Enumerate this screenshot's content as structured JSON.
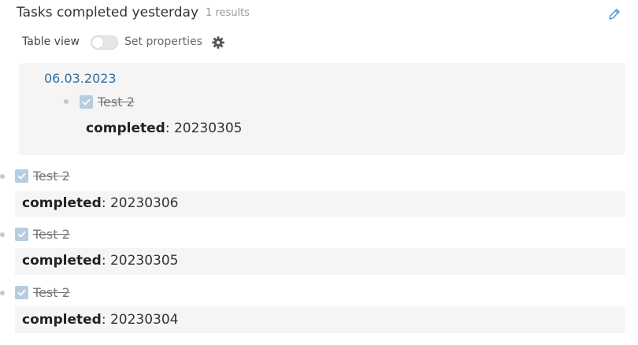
{
  "header": {
    "title": "Tasks completed yesterday",
    "results": "1 results"
  },
  "controls": {
    "table_view_label": "Table view",
    "table_view_on": false,
    "set_properties_label": "Set properties"
  },
  "group": {
    "title": "06.03.2023",
    "task": {
      "text": "Test 2",
      "checked": true,
      "property_key": "completed",
      "property_sep": ":",
      "property_value": "20230305"
    }
  },
  "tasks": [
    {
      "text": "Test 2",
      "checked": true,
      "property_key": "completed",
      "property_sep": ":",
      "property_value": "20230306"
    },
    {
      "text": "Test 2",
      "checked": true,
      "property_key": "completed",
      "property_sep": ":",
      "property_value": "20230305"
    },
    {
      "text": "Test 2",
      "checked": true,
      "property_key": "completed",
      "property_sep": ":",
      "property_value": "20230304"
    }
  ],
  "colors": {
    "link": "#2f6ea1",
    "checkbox": "#b8cce0",
    "panel": "#f5f5f5",
    "edit_icon": "#4a90c8"
  },
  "icons": {
    "edit": "pencil-icon",
    "settings": "gear-icon",
    "check": "check-icon"
  }
}
